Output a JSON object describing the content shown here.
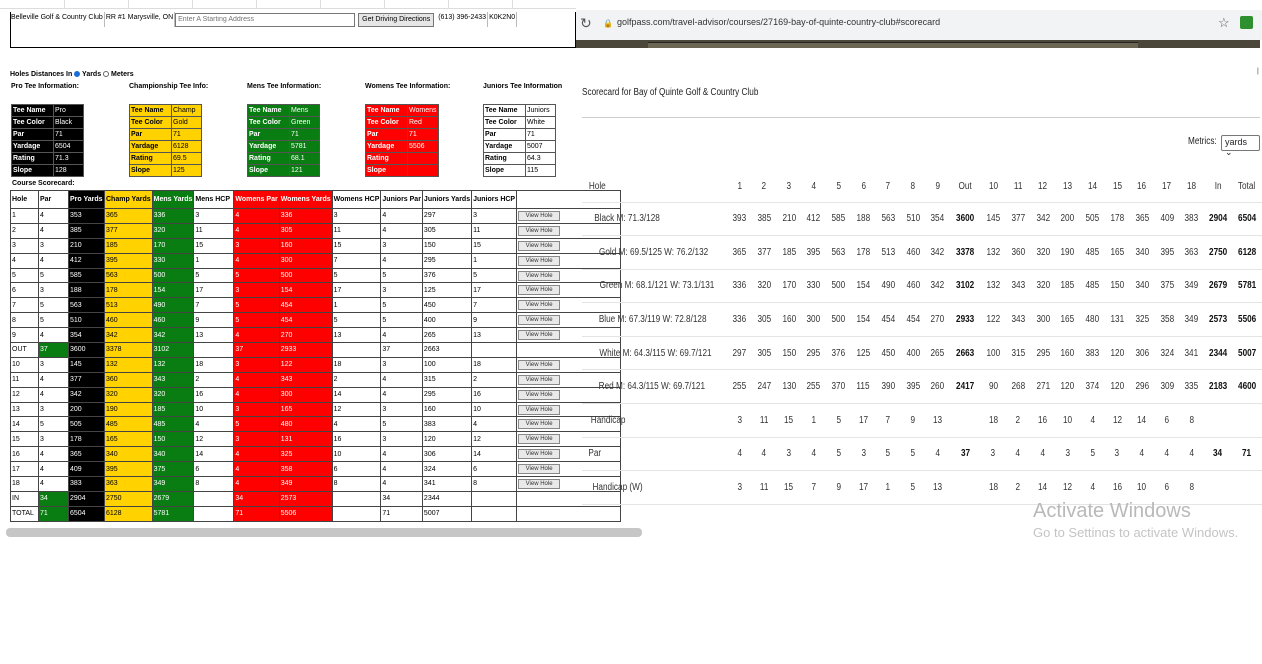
{
  "left_page": {
    "address_row": {
      "course_name": "Belleville Golf & Country Club",
      "address": "RR #1 Marysville, ON",
      "start_placeholder": "Enter A Starting Address",
      "directions_button": "Get Driving Directions",
      "phone": "(613) 396-2433",
      "postal": "K0K2N0"
    },
    "units": {
      "label": "Holes Distances In",
      "yards": "Yards",
      "meters": "Meters",
      "selected": "yards"
    },
    "tee_headers": [
      "Pro Tee Information:",
      "Championship Tee Info:",
      "Mens Tee Information:",
      "Womens Tee Information:",
      "Juniors Tee Information"
    ],
    "tee_boxes": [
      {
        "color_class": "c-black",
        "rows": [
          [
            "Tee Name",
            "Pro"
          ],
          [
            "Tee Color",
            "Black"
          ],
          [
            "Par",
            "71"
          ],
          [
            "Yardage",
            "6504"
          ],
          [
            "Rating",
            "71.3"
          ],
          [
            "Slope",
            "128"
          ]
        ]
      },
      {
        "color_class": "c-gold",
        "rows": [
          [
            "Tee Name",
            "Champ"
          ],
          [
            "Tee Color",
            "Gold"
          ],
          [
            "Par",
            "71"
          ],
          [
            "Yardage",
            "6128"
          ],
          [
            "Rating",
            "69.5"
          ],
          [
            "Slope",
            "125"
          ]
        ]
      },
      {
        "color_class": "c-green",
        "rows": [
          [
            "Tee Name",
            "Mens"
          ],
          [
            "Tee Color",
            "Green"
          ],
          [
            "Par",
            "71"
          ],
          [
            "Yardage",
            "5781"
          ],
          [
            "Rating",
            "68.1"
          ],
          [
            "Slope",
            "121"
          ]
        ]
      },
      {
        "color_class": "c-red",
        "rows": [
          [
            "Tee Name",
            "Womens"
          ],
          [
            "Tee Color",
            "Red"
          ],
          [
            "Par",
            "71"
          ],
          [
            "Yardage",
            "5506"
          ],
          [
            "Rating",
            ""
          ],
          [
            "Slope",
            ""
          ]
        ]
      },
      {
        "color_class": "c-white",
        "rows": [
          [
            "Tee Name",
            "Juniors"
          ],
          [
            "Tee Color",
            "White"
          ],
          [
            "Par",
            "71"
          ],
          [
            "Yardage",
            "5007"
          ],
          [
            "Rating",
            "64.3"
          ],
          [
            "Slope",
            "115"
          ]
        ]
      }
    ],
    "course_scorecard_title": "Course Scorecard:",
    "scorecard_headers": [
      "Hole",
      "Par",
      "Pro Yards",
      "Champ Yards",
      "Mens Yards",
      "Mens HCP",
      "Womens Par",
      "Womens Yards",
      "Womens HCP",
      "Juniors Par",
      "Juniors Yards",
      "Juniors HCP",
      ""
    ],
    "view_hole_label": "View Hole",
    "scorecard_rows": [
      [
        "1",
        "4",
        "353",
        "365",
        "336",
        "3",
        "4",
        "336",
        "3",
        "4",
        "297",
        "3",
        true
      ],
      [
        "2",
        "4",
        "385",
        "377",
        "320",
        "11",
        "4",
        "305",
        "11",
        "4",
        "305",
        "11",
        true
      ],
      [
        "3",
        "3",
        "210",
        "185",
        "170",
        "15",
        "3",
        "160",
        "15",
        "3",
        "150",
        "15",
        true
      ],
      [
        "4",
        "4",
        "412",
        "395",
        "330",
        "1",
        "4",
        "300",
        "7",
        "4",
        "295",
        "1",
        true
      ],
      [
        "5",
        "5",
        "585",
        "563",
        "500",
        "5",
        "5",
        "500",
        "5",
        "5",
        "376",
        "5",
        true
      ],
      [
        "6",
        "3",
        "188",
        "178",
        "154",
        "17",
        "3",
        "154",
        "17",
        "3",
        "125",
        "17",
        true
      ],
      [
        "7",
        "5",
        "563",
        "513",
        "490",
        "7",
        "5",
        "454",
        "1",
        "5",
        "450",
        "7",
        true
      ],
      [
        "8",
        "5",
        "510",
        "460",
        "460",
        "9",
        "5",
        "454",
        "5",
        "5",
        "400",
        "9",
        true
      ],
      [
        "9",
        "4",
        "354",
        "342",
        "342",
        "13",
        "4",
        "270",
        "13",
        "4",
        "265",
        "13",
        true
      ],
      [
        "OUT",
        "37",
        "3600",
        "3378",
        "3102",
        "",
        "37",
        "2933",
        "",
        "37",
        "2663",
        "",
        false
      ],
      [
        "10",
        "3",
        "145",
        "132",
        "132",
        "18",
        "3",
        "122",
        "18",
        "3",
        "100",
        "18",
        true
      ],
      [
        "11",
        "4",
        "377",
        "360",
        "343",
        "2",
        "4",
        "343",
        "2",
        "4",
        "315",
        "2",
        true
      ],
      [
        "12",
        "4",
        "342",
        "320",
        "320",
        "16",
        "4",
        "300",
        "14",
        "4",
        "295",
        "16",
        true
      ],
      [
        "13",
        "3",
        "200",
        "190",
        "185",
        "10",
        "3",
        "165",
        "12",
        "3",
        "160",
        "10",
        true
      ],
      [
        "14",
        "5",
        "505",
        "485",
        "485",
        "4",
        "5",
        "480",
        "4",
        "5",
        "383",
        "4",
        true
      ],
      [
        "15",
        "3",
        "178",
        "165",
        "150",
        "12",
        "3",
        "131",
        "16",
        "3",
        "120",
        "12",
        true
      ],
      [
        "16",
        "4",
        "365",
        "340",
        "340",
        "14",
        "4",
        "325",
        "10",
        "4",
        "306",
        "14",
        true
      ],
      [
        "17",
        "4",
        "409",
        "395",
        "375",
        "6",
        "4",
        "358",
        "6",
        "4",
        "324",
        "6",
        true
      ],
      [
        "18",
        "4",
        "383",
        "363",
        "349",
        "8",
        "4",
        "349",
        "8",
        "4",
        "341",
        "8",
        true
      ],
      [
        "IN",
        "34",
        "2904",
        "2750",
        "2679",
        "",
        "34",
        "2573",
        "",
        "34",
        "2344",
        "",
        false
      ],
      [
        "TOTAL",
        "71",
        "6504",
        "6128",
        "5781",
        "",
        "71",
        "5506",
        "",
        "71",
        "5007",
        "",
        false
      ]
    ]
  },
  "browser": {
    "url": "golfpass.com/travel-advisor/courses/27169-bay-of-quinte-country-club#scorecard",
    "reload_icon": "reload-icon",
    "lock_icon": "lock-icon",
    "star_icon": "star-icon"
  },
  "golfpass": {
    "title": "Scorecard for Bay of Quinte Golf & Country Club",
    "metrics_label": "Metrics:",
    "metrics_value": "yards",
    "headers": [
      "Hole",
      "1",
      "2",
      "3",
      "4",
      "5",
      "6",
      "7",
      "8",
      "9",
      "Out",
      "10",
      "11",
      "12",
      "13",
      "14",
      "15",
      "16",
      "17",
      "18",
      "In",
      "Total"
    ],
    "rows": [
      [
        "Black M: 71.3/128",
        "393",
        "385",
        "210",
        "412",
        "585",
        "188",
        "563",
        "510",
        "354",
        "3600",
        "145",
        "377",
        "342",
        "200",
        "505",
        "178",
        "365",
        "409",
        "383",
        "2904",
        "6504"
      ],
      [
        "Gold M: 69.5/125 W: 76.2/132",
        "365",
        "377",
        "185",
        "395",
        "563",
        "178",
        "513",
        "460",
        "342",
        "3378",
        "132",
        "360",
        "320",
        "190",
        "485",
        "165",
        "340",
        "395",
        "363",
        "2750",
        "6128"
      ],
      [
        "Green M: 68.1/121 W: 73.1/131",
        "336",
        "320",
        "170",
        "330",
        "500",
        "154",
        "490",
        "460",
        "342",
        "3102",
        "132",
        "343",
        "320",
        "185",
        "485",
        "150",
        "340",
        "375",
        "349",
        "2679",
        "5781"
      ],
      [
        "Blue M: 67.3/119 W: 72.8/128",
        "336",
        "305",
        "160",
        "300",
        "500",
        "154",
        "454",
        "454",
        "270",
        "2933",
        "122",
        "343",
        "300",
        "165",
        "480",
        "131",
        "325",
        "358",
        "349",
        "2573",
        "5506"
      ],
      [
        "White M: 64.3/115 W: 69.7/121",
        "297",
        "305",
        "150",
        "295",
        "376",
        "125",
        "450",
        "400",
        "265",
        "2663",
        "100",
        "315",
        "295",
        "160",
        "383",
        "120",
        "306",
        "324",
        "341",
        "2344",
        "5007"
      ],
      [
        "Red M: 64.3/115 W: 69.7/121",
        "255",
        "247",
        "130",
        "255",
        "370",
        "115",
        "390",
        "395",
        "260",
        "2417",
        "90",
        "268",
        "271",
        "120",
        "374",
        "120",
        "296",
        "309",
        "335",
        "2183",
        "4600"
      ],
      [
        "Handicap",
        "3",
        "11",
        "15",
        "1",
        "5",
        "17",
        "7",
        "9",
        "13",
        "",
        "18",
        "2",
        "16",
        "10",
        "4",
        "12",
        "14",
        "6",
        "8",
        "",
        ""
      ],
      [
        "Par",
        "4",
        "4",
        "3",
        "4",
        "5",
        "3",
        "5",
        "5",
        "4",
        "37",
        "3",
        "4",
        "4",
        "3",
        "5",
        "3",
        "4",
        "4",
        "4",
        "34",
        "71"
      ],
      [
        "Handicap (W)",
        "3",
        "11",
        "15",
        "7",
        "9",
        "17",
        "1",
        "5",
        "13",
        "",
        "18",
        "2",
        "14",
        "12",
        "4",
        "16",
        "10",
        "6",
        "8",
        "",
        ""
      ]
    ]
  },
  "watermark": {
    "line1": "Activate Windows",
    "line2": "Go to Settings to activate Windows."
  }
}
